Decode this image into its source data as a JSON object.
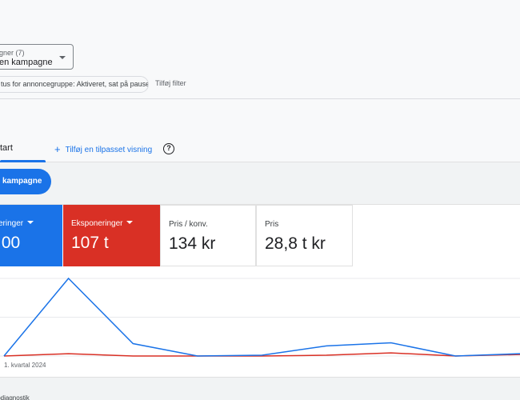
{
  "campaign_select": {
    "label": "gner (7)",
    "value": "en kampagne"
  },
  "filters": {
    "chip": "tus for annoncegruppe: Aktiveret, sat på pause",
    "add_filter": "Tilføj filter"
  },
  "tabs": {
    "overview": "tart",
    "add_view": "Tilføj en tilpasset visning",
    "add_view_icon": "plus-icon",
    "help_icon": "help-circle-icon"
  },
  "new_campaign_button": "kampagne",
  "metrics": [
    {
      "label": "eringer",
      "value": ",00",
      "color": "#1a73e8",
      "dropdown": true
    },
    {
      "label": "Eksponeringer",
      "value": "107 t",
      "color": "#d93025",
      "dropdown": true
    },
    {
      "label": "Pris / konv.",
      "value": "134 kr"
    },
    {
      "label": "Pris",
      "value": "28,8 t kr"
    }
  ],
  "chart_data": {
    "type": "line",
    "x": [
      0,
      1,
      2,
      3,
      4,
      5,
      6,
      7,
      8
    ],
    "x_tick_labels": [
      "1. kvartal 2024"
    ],
    "series": [
      {
        "values": [
          0,
          1,
          0.16,
          0,
          0.01,
          0.13,
          0.17,
          0,
          0.03
        ],
        "color": "#1a73e8"
      },
      {
        "values": [
          0,
          0.03,
          0,
          0,
          0,
          0.01,
          0.04,
          0,
          0.02
        ],
        "color": "#d93025"
      }
    ],
    "ylim": [
      0,
      1
    ],
    "grid": true,
    "legend": "none"
  },
  "bottom": {
    "text": "todiagnostik"
  }
}
